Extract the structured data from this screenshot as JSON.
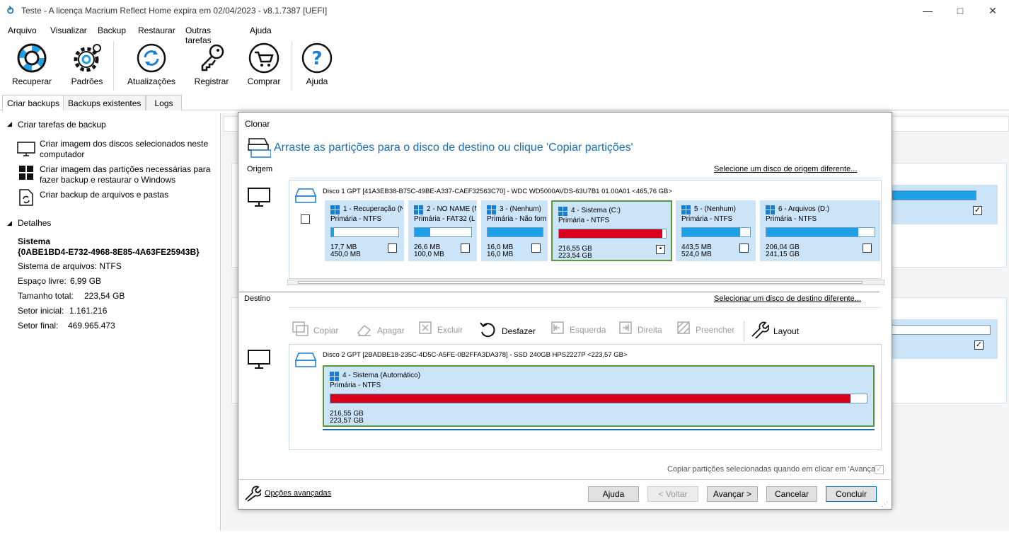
{
  "window": {
    "title": "Teste - A licença Macrium Reflect Home expira em 02/04/2023 - v8.1.7387  [UEFI]"
  },
  "menu": [
    "Arquivo",
    "Visualizar",
    "Backup",
    "Restaurar",
    "Outras tarefas",
    "Ajuda"
  ],
  "toolbar": {
    "recover": "Recuperar",
    "defaults": "Padrões",
    "updates": "Atualizações",
    "register": "Registrar",
    "buy": "Comprar",
    "help": "Ajuda"
  },
  "tabs": [
    "Criar backups",
    "Backups existentes",
    "Logs"
  ],
  "left": {
    "tasks_header": "Criar tarefas de backup",
    "task1": "Criar imagem dos discos selecionados neste computador",
    "task2": "Criar imagem das partições necessárias para fazer backup e restaurar o Windows",
    "task3": "Criar backup de arquivos e pastas",
    "details_header": "Detalhes",
    "system_label": "Sistema",
    "system_id": "{0ABE1BD4-E732-4968-8E85-4A63FE25943B}",
    "fs": "Sistema de arquivos: NTFS",
    "free_label": "Espaço livre:",
    "free": "6,99 GB",
    "total_label": "Tamanho total:",
    "total": "223,54 GB",
    "start_label": "Setor inicial:",
    "start": "1.161.216",
    "end_label": "Setor final:",
    "end": "469.965.473"
  },
  "dialog": {
    "title": "Clonar",
    "instruction": "Arraste as partições para o disco de destino ou clique 'Copiar partições'",
    "source_label": "Origem",
    "source_link": "Selecione um disco de origem diferente...",
    "source_disk": "Disco 1 GPT [41A3EB38-B75C-49BE-A337-CAEF32563C70] - WDC WD5000AVDS-63U7B1 01.00A01  <465,76 GB>",
    "partitions": [
      {
        "name": "1 - Recuperação (N",
        "type": "Primária - NTFS",
        "used": "17,7 MB",
        "size": "450,0 MB",
        "fill": 0.04,
        "color": "#1ea0e6"
      },
      {
        "name": "2 - NO NAME (N",
        "type": "Primária - FAT32 (LB",
        "used": "26,6 MB",
        "size": "100,0 MB",
        "fill": 0.27,
        "color": "#1ea0e6"
      },
      {
        "name": "3 - (Nenhum)",
        "type": "Primária - Não form",
        "used": "16,0 MB",
        "size": "16,0 MB",
        "fill": 1.0,
        "color": "#1ea0e6"
      },
      {
        "name": "4 - Sistema (C:)",
        "type": "Primária - NTFS",
        "used": "216,55 GB",
        "size": "223,54 GB",
        "fill": 0.97,
        "color": "#d9001b"
      },
      {
        "name": "5 - (Nenhum)",
        "type": "Primária - NTFS",
        "used": "443,5 MB",
        "size": "524,0 MB",
        "fill": 0.85,
        "color": "#1ea0e6"
      },
      {
        "name": "6 - Arquivos (D:)",
        "type": "Primária - NTFS",
        "used": "206,04 GB",
        "size": "241,15 GB",
        "fill": 0.85,
        "color": "#1ea0e6"
      }
    ],
    "dest_label": "Destino",
    "dest_link": "Selecionar um disco de destino diferente...",
    "tools": {
      "copy": "Copiar",
      "erase": "Apagar",
      "delete": "Excluir",
      "undo": "Desfazer",
      "left": "Esquerda",
      "right": "Direita",
      "fill": "Preencher",
      "layout": "Layout"
    },
    "dest_disk": "Disco 2 GPT [2BADBE18-235C-4D5C-A5FE-0B2FFA3DA378] - SSD 240GB HPS2227P  <223,57 GB>",
    "dest_part": {
      "name": "4 - Sistema (Automático)",
      "type": "Primária - NTFS",
      "used": "216,55 GB",
      "size": "223,57 GB",
      "fill": 0.97
    },
    "auto_copy": "Copiar partições selecionadas quando em clicar em 'Avançar'",
    "advanced": "Opções avançadas",
    "buttons": {
      "help": "Ajuda",
      "back": "< Voltar",
      "next": "Avançar >",
      "cancel": "Cancelar",
      "finish": "Concluir"
    }
  },
  "colors": {
    "accent": "#1a6fb3",
    "used_bar": "#1ea0e6",
    "system_bar": "#d9001b",
    "selected_border": "#5b9a3c"
  }
}
